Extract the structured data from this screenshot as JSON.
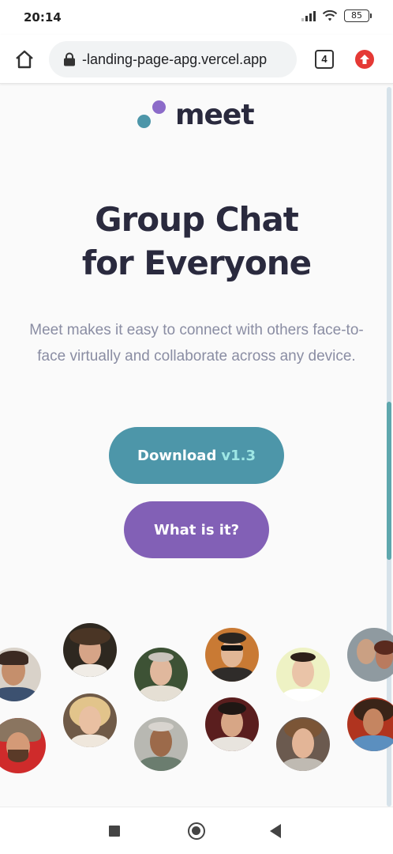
{
  "status_bar": {
    "time": "20:14",
    "battery": "85"
  },
  "browser": {
    "url": "-landing-page-apg.vercel.app",
    "tab_count": "4"
  },
  "page": {
    "logo_text": "meet",
    "headline_line1": "Group Chat",
    "headline_line2": "for Everyone",
    "description": "Meet makes it easy to connect with others face-to-face virtually and collaborate across any device.",
    "download_label": "Download",
    "download_version": "v1.3",
    "what_label": "What is it?"
  },
  "colors": {
    "teal": "#4d96a9",
    "purple": "#8260b6",
    "heading": "#2a2a3e",
    "body_text": "#8a8da3"
  }
}
